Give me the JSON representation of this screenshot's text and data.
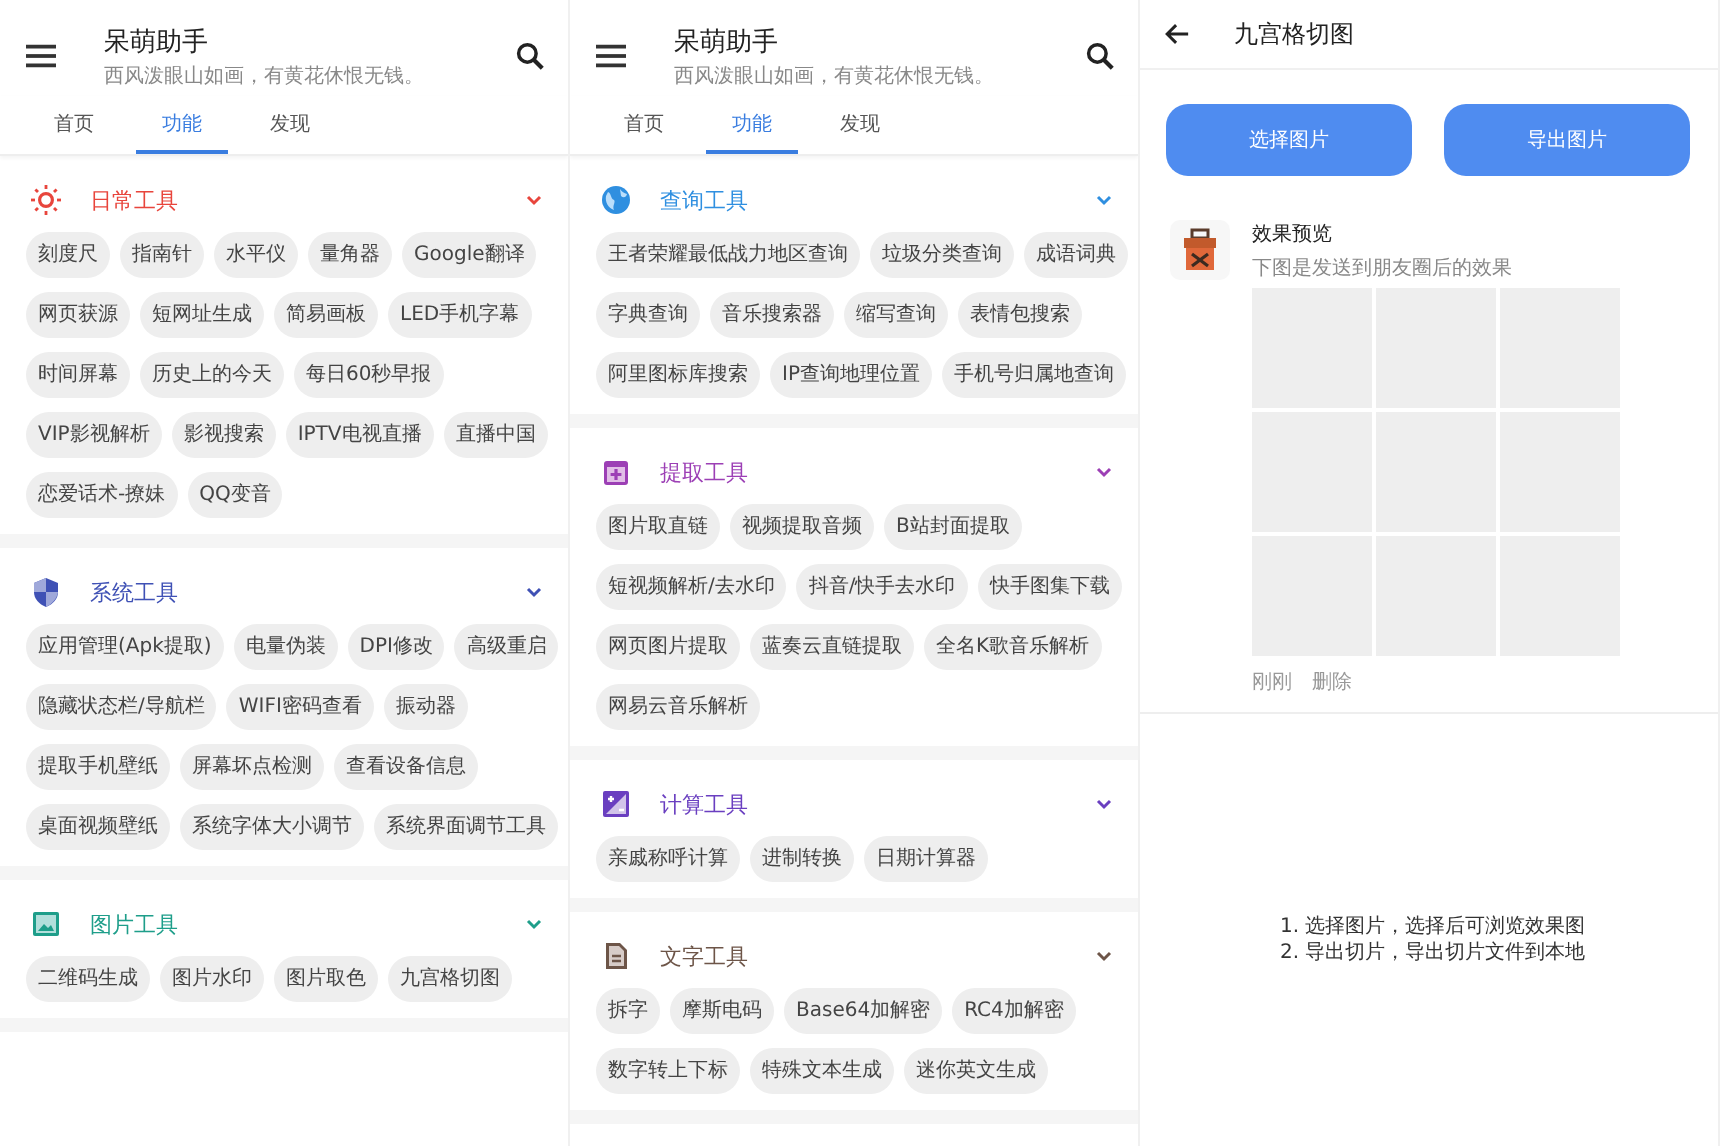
{
  "panels": [
    {
      "kind": "tools",
      "title": "呆萌助手",
      "subtitle": "西风泼眼山如画，有黄花休恨无钱。",
      "tabs": [
        {
          "label": "首页",
          "selected": false
        },
        {
          "label": "功能",
          "selected": true
        },
        {
          "label": "发现",
          "selected": false
        }
      ],
      "sections": [
        {
          "title": "日常工具",
          "color": "#e8453c",
          "expanded": true,
          "items": [
            "刻度尺",
            "指南针",
            "水平仪",
            "量角器",
            "Google翻译",
            "网页获源",
            "短网址生成",
            "简易画板",
            "LED手机字幕",
            "时间屏幕",
            "历史上的今天",
            "每日60秒早报",
            "VIP影视解析",
            "影视搜索",
            "IPTV电视直播",
            "直播中国",
            "恋爱话术-撩妹",
            "QQ变音"
          ]
        },
        {
          "title": "系统工具",
          "color": "#3f51b5",
          "expanded": true,
          "items": [
            "应用管理(Apk提取)",
            "电量伪装",
            "DPI修改",
            "高级重启",
            "隐藏状态栏/导航栏",
            "WIFI密码查看",
            "振动器",
            "提取手机壁纸",
            "屏幕坏点检测",
            "查看设备信息",
            "桌面视频壁纸",
            "系统字体大小调节",
            "系统界面调节工具"
          ]
        },
        {
          "title": "图片工具",
          "color": "#1e9e8a",
          "expanded": true,
          "items": [
            "二维码生成",
            "图片水印",
            "图片取色",
            "九宫格切图"
          ]
        }
      ]
    },
    {
      "kind": "tools",
      "title": "呆萌助手",
      "subtitle": "西风泼眼山如画，有黄花休恨无钱。",
      "tabs": [
        {
          "label": "首页",
          "selected": false
        },
        {
          "label": "功能",
          "selected": true
        },
        {
          "label": "发现",
          "selected": false
        }
      ],
      "sections": [
        {
          "title": "查询工具",
          "color": "#2f8fe0",
          "expanded": true,
          "items": [
            "王者荣耀最低战力地区查询",
            "垃圾分类查询",
            "成语词典",
            "字典查询",
            "音乐搜索器",
            "缩写查询",
            "表情包搜索",
            "阿里图标库搜索",
            "IP查询地理位置",
            "手机号归属地查询"
          ]
        },
        {
          "title": "提取工具",
          "color": "#9c3fb5",
          "expanded": true,
          "items": [
            "图片取直链",
            "视频提取音频",
            "B站封面提取",
            "短视频解析/去水印",
            "抖音/快手去水印",
            "快手图集下载",
            "网页图片提取",
            "蓝奏云直链提取",
            "全名K歌音乐解析",
            "网易云音乐解析"
          ]
        },
        {
          "title": "计算工具",
          "color": "#6a3fc0",
          "expanded": true,
          "items": [
            "亲戚称呼计算",
            "进制转换",
            "日期计算器"
          ]
        },
        {
          "title": "文字工具",
          "color": "#6d5548",
          "expanded": true,
          "items": [
            "拆字",
            "摩斯电码",
            "Base64加解密",
            "RC4加解密",
            "数字转上下标",
            "特殊文本生成",
            "迷你英文生成"
          ]
        }
      ]
    },
    {
      "kind": "grid_cut",
      "title": "九宫格切图",
      "buttons": [
        "选择图片",
        "导出图片"
      ],
      "preview_title": "效果预览",
      "preview_caption": "下图是发送到朋友圈后的效果",
      "time": "刚刚",
      "delete": "删除",
      "instructions": [
        "1. 选择图片，选择后可浏览效果图",
        "2. 导出切片，导出切片文件到本地"
      ]
    }
  ]
}
